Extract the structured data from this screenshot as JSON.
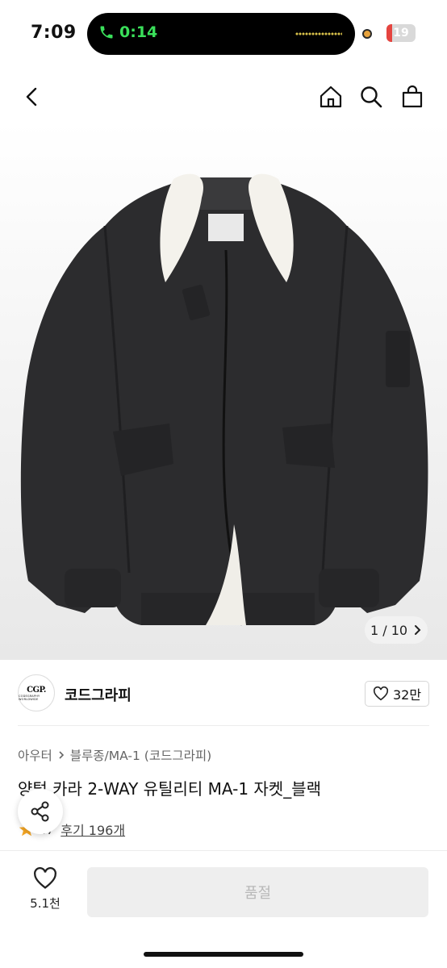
{
  "status_bar": {
    "time": "7:09",
    "call_timer": "0:14",
    "battery_level": "19",
    "battery_fraction": 0.19,
    "call_color": "#3adf5a",
    "battery_color": "#e5443f"
  },
  "nav": {
    "back_icon": "chevron-left-icon",
    "home_icon": "home-icon",
    "search_icon": "search-icon",
    "cart_icon": "shopping-bag-icon"
  },
  "gallery": {
    "current": "1",
    "total": "10",
    "separator": "/",
    "next_icon": "chevron-right-icon"
  },
  "brand": {
    "logo_line1": "CGP.",
    "logo_line2": "CODEGRAPHY WORLDWIDE",
    "name": "코드그라피",
    "like_count": "32만"
  },
  "product": {
    "breadcrumb": [
      "아우터",
      "블루종/MA-1 (코드그라피)"
    ],
    "title": "양털 카라 2-WAY 유틸리티 MA-1 자켓_블랙",
    "rating_partial": ".7",
    "review_label": "후기 196개",
    "star_color": "#f5a623"
  },
  "bottom_bar": {
    "wish_count": "5.1천",
    "buy_label": "품절"
  }
}
